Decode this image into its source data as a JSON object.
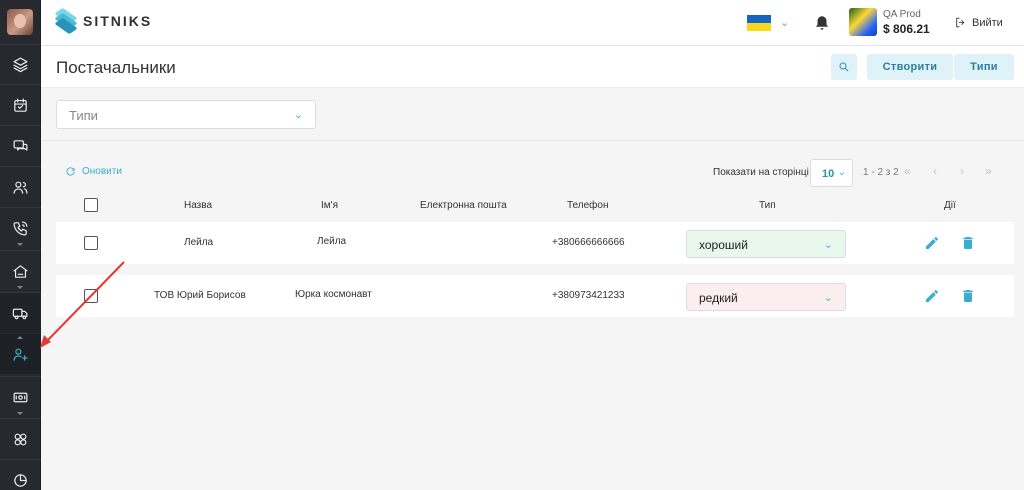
{
  "app": {
    "brand": "SITNIKS"
  },
  "topbar": {
    "account_name": "QA Prod",
    "balance": "$ 806.21",
    "logout_label": "Вийти"
  },
  "sidebar": {
    "items": [
      {
        "icon": "layers-icon"
      },
      {
        "icon": "calendar-icon"
      },
      {
        "icon": "chat-icon"
      },
      {
        "icon": "users-icon"
      },
      {
        "icon": "phone-icon"
      },
      {
        "icon": "home-icon"
      },
      {
        "icon": "truck-icon"
      },
      {
        "icon": "user-plus-icon",
        "active": true
      },
      {
        "icon": "cash-icon"
      },
      {
        "icon": "integrations-icon"
      },
      {
        "icon": "pie-chart-icon"
      }
    ]
  },
  "page": {
    "title": "Постачальники",
    "create_label": "Створити",
    "types_label": "Типи"
  },
  "filter": {
    "placeholder": "Типи"
  },
  "table": {
    "refresh_label": "Оновити",
    "per_page_label": "Показати на сторінці",
    "per_page_value": "10",
    "range": "1 - 2 з 2",
    "columns": {
      "name": "Назва",
      "first_name": "Ім'я",
      "email": "Електронна пошта",
      "phone": "Телефон",
      "type": "Тип",
      "actions": "Дії"
    },
    "rows": [
      {
        "name": "Лейла",
        "first_name": "Лейла",
        "email": "",
        "phone": "+380666666666",
        "type": "хороший",
        "type_color": "#e8f8ec"
      },
      {
        "name": "ТОВ Юрий Борисов",
        "first_name": "Юрка космонавт",
        "email": "",
        "phone": "+380973421233",
        "type": "редкий",
        "type_color": "#fbeeee"
      }
    ]
  },
  "colors": {
    "accent": "#3aaed0",
    "sidebar_bg": "#26292e",
    "annotation": "#e53935"
  }
}
